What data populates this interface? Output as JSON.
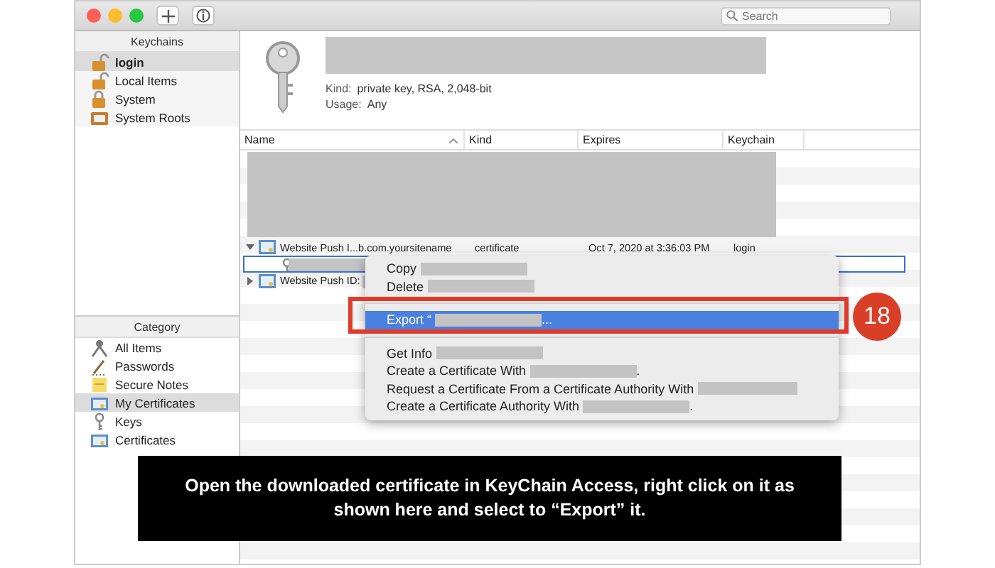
{
  "toolbar": {
    "search": {
      "placeholder": "Search"
    }
  },
  "sidebar": {
    "keychains_header": "Keychains",
    "keychains": [
      {
        "label": "login",
        "selected": true
      },
      {
        "label": "Local Items",
        "selected": false
      },
      {
        "label": "System",
        "selected": false
      },
      {
        "label": "System Roots",
        "selected": false
      }
    ],
    "category_header": "Category",
    "categories": [
      {
        "label": "All Items",
        "selected": false
      },
      {
        "label": "Passwords",
        "selected": false
      },
      {
        "label": "Secure Notes",
        "selected": false
      },
      {
        "label": "My Certificates",
        "selected": true
      },
      {
        "label": "Keys",
        "selected": false
      },
      {
        "label": "Certificates",
        "selected": false
      }
    ]
  },
  "info": {
    "fields": [
      {
        "label": "Kind:",
        "value": "private key, RSA, 2,048-bit"
      },
      {
        "label": "Usage:",
        "value": "Any"
      }
    ]
  },
  "table": {
    "columns": [
      "Name",
      "Kind",
      "Expires",
      "Keychain"
    ],
    "rows": [
      {
        "name": "Website Push I...b.com.yoursitename",
        "kind": "certificate",
        "expires": "Oct 7, 2020 at 3:36:03 PM",
        "keychain": "login",
        "expanded": true,
        "selected": false,
        "children": [
          {
            "selected": true
          }
        ]
      },
      {
        "name": "Website Push ID:",
        "expanded": false,
        "selected": false
      }
    ]
  },
  "context_menu": {
    "groups": [
      [
        {
          "label": "Copy",
          "selected": false
        },
        {
          "label": "Delete",
          "selected": false
        }
      ],
      [
        {
          "label": "Export “",
          "suffix": "...",
          "selected": true
        }
      ],
      [
        {
          "label": "Get Info",
          "selected": false
        },
        {
          "label": "Create a Certificate With",
          "suffix": ".",
          "selected": false
        },
        {
          "label": "Request a Certificate From a Certificate Authority With",
          "selected": false
        },
        {
          "label": "Create a Certificate Authority With",
          "suffix": ".",
          "selected": false
        }
      ]
    ]
  },
  "callout": {
    "number": "18"
  },
  "caption": "Open the downloaded certificate in KeyChain Access, right click on it as shown here and select to “Export” it."
}
